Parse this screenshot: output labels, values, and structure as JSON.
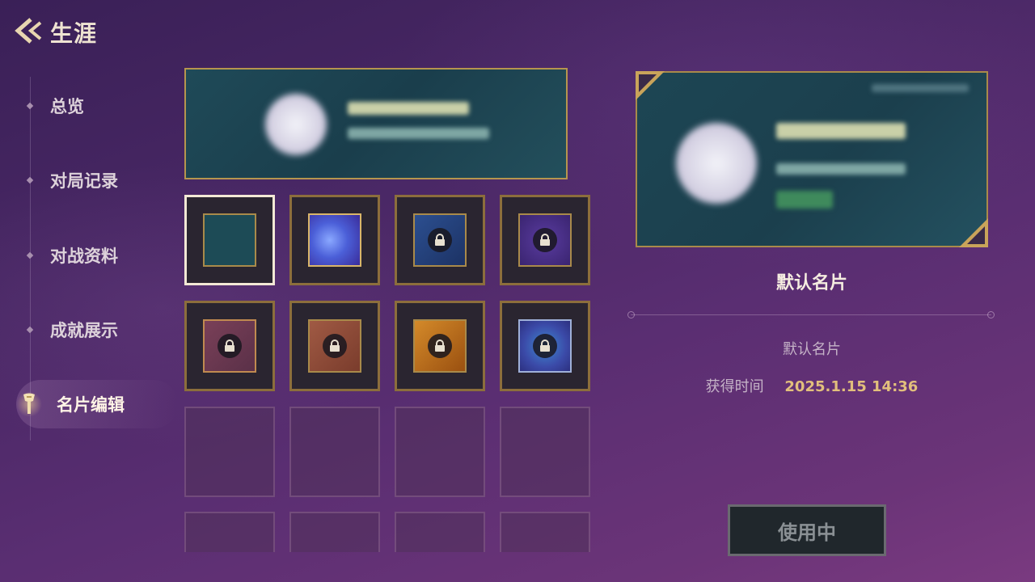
{
  "header": {
    "title": "生涯",
    "back_icon": "back-chevron-icon"
  },
  "sidebar": {
    "items": [
      {
        "label": "总览",
        "active": false
      },
      {
        "label": "对局记录",
        "active": false
      },
      {
        "label": "对战资料",
        "active": false
      },
      {
        "label": "成就展示",
        "active": false
      },
      {
        "label": "名片编辑",
        "active": true,
        "icon": "torch-icon"
      }
    ]
  },
  "grid": {
    "cards": [
      {
        "name": "default-card",
        "locked": false,
        "selected": true,
        "color": "#1d4b56"
      },
      {
        "name": "galaxy-card",
        "locked": false,
        "selected": false,
        "color": "#4b5fd8"
      },
      {
        "name": "blue-ornate-card",
        "locked": true,
        "selected": false,
        "color": "#24407a"
      },
      {
        "name": "purple-floral-card",
        "locked": true,
        "selected": false,
        "color": "#4a2e86"
      },
      {
        "name": "red-dragon-card",
        "locked": true,
        "selected": false,
        "color": "#6a3850"
      },
      {
        "name": "copper-card",
        "locked": true,
        "selected": false,
        "color": "#8a4a38"
      },
      {
        "name": "amber-card",
        "locked": true,
        "selected": false,
        "color": "#b86a1a"
      },
      {
        "name": "azure-dragon-card",
        "locked": true,
        "selected": false,
        "color": "#3b4aa8"
      }
    ],
    "empty_slots": 8
  },
  "detail": {
    "name": "默认名片",
    "description": "默认名片",
    "obtain_label": "获得时间",
    "obtain_value": "2025.1.15  14:36",
    "button_label": "使用中"
  },
  "colors": {
    "gold_border": "#b6954e",
    "accent_gold": "#e2bf7c",
    "card_teal": "#1f4a58"
  }
}
